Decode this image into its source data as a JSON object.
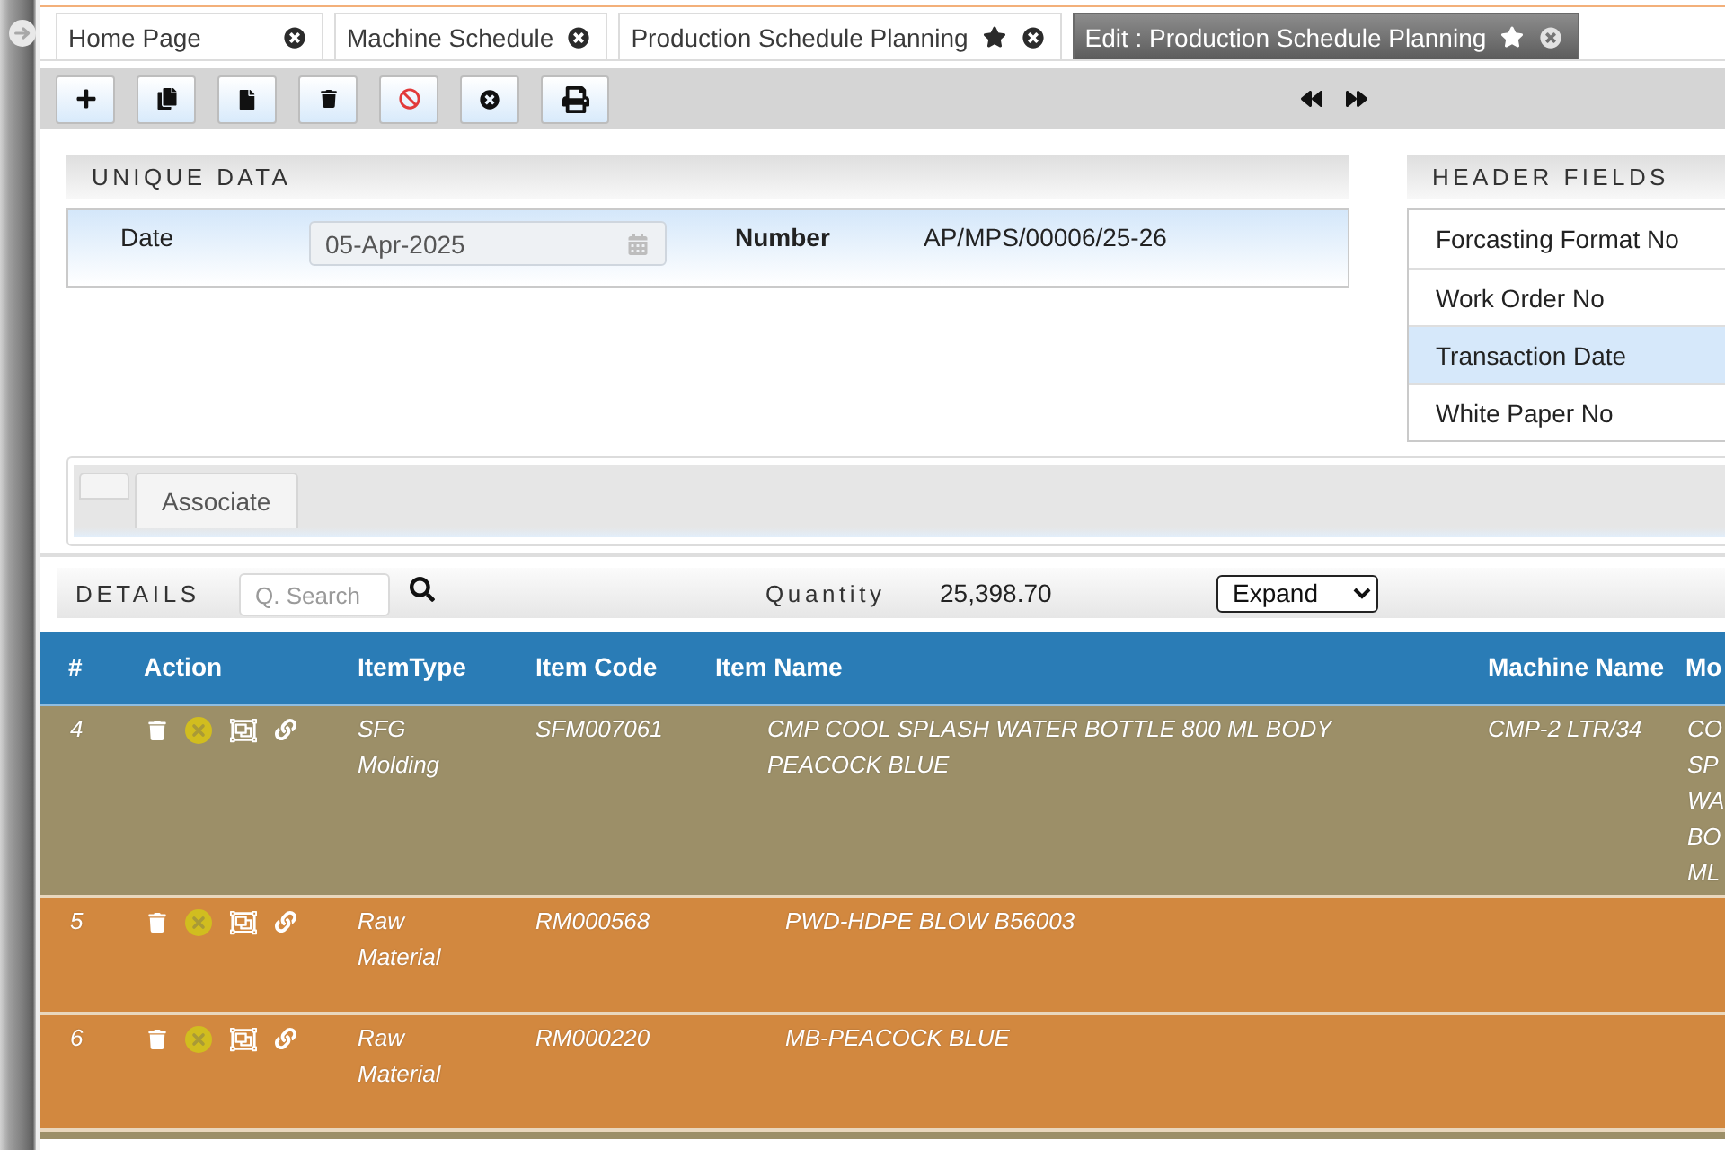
{
  "tabs": [
    {
      "label": "Home Page",
      "selected": false,
      "favorite": false
    },
    {
      "label": "Machine Schedule",
      "selected": false,
      "favorite": false
    },
    {
      "label": "Production Schedule Planning",
      "selected": false,
      "favorite": true
    },
    {
      "label": "Edit : Production Schedule Planning",
      "selected": true,
      "favorite": true
    }
  ],
  "unique_data": {
    "title": "UNIQUE DATA",
    "fields": [
      {
        "kind": "date",
        "label": "Date",
        "value": "05-Apr-2025"
      },
      {
        "kind": "text",
        "label": "Number",
        "value": "AP/MPS/00006/25-26"
      }
    ]
  },
  "header_fields": {
    "title": "HEADER FIELDS",
    "items": [
      {
        "label": "Forcasting Format No",
        "selected": false
      },
      {
        "label": "Work Order No",
        "selected": false
      },
      {
        "label": "Transaction Date",
        "selected": true
      },
      {
        "label": "White Paper No",
        "selected": false
      }
    ]
  },
  "sub_tabs": [
    {
      "kind": "blank"
    },
    {
      "kind": "label",
      "label": "Associate"
    }
  ],
  "details": {
    "title": "DETAILS",
    "search": {
      "placeholder": "Q. Search"
    },
    "quantity_label": "Quantity",
    "quantity": "25,398.70",
    "view_select": "Expand"
  },
  "table": {
    "columns": [
      "#",
      "Action",
      "ItemType",
      "Item Code",
      "Item Name",
      "Machine Name",
      "Mo"
    ],
    "rows": [
      {
        "no": "4",
        "color": "#9c8f68",
        "item_type": "SFG Molding",
        "item_code": "SFM007061",
        "item_name": "CMP COOL SPLASH WATER BOTTLE 800 ML BODY PEACOCK BLUE",
        "machine_name": "CMP-2 LTR/34",
        "column_7": "CO SP WA BO ML",
        "children": [
          {
            "no": "5",
            "color": "#d2883f",
            "item_type": "Raw Material",
            "item_code": "RM000568",
            "item_name": "PWD-HDPE BLOW B56003"
          },
          {
            "no": "6",
            "color": "#d2883f",
            "item_type": "Raw Material",
            "item_code": "RM000220",
            "item_name": "MB-PEACOCK BLUE"
          }
        ]
      }
    ]
  }
}
